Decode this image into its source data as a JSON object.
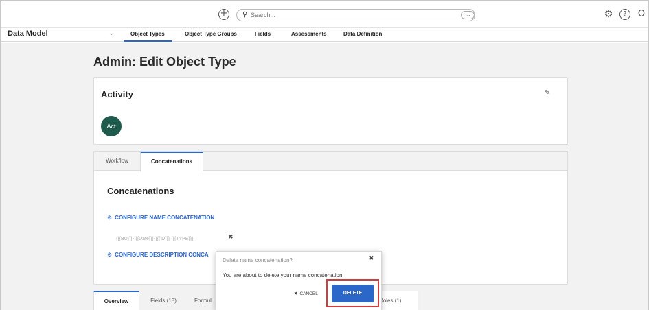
{
  "topbar": {
    "add_icon": "plus-circle-icon",
    "search": {
      "placeholder": "Search...",
      "more_label": "..."
    },
    "settings_icon": "gear-icon",
    "help_icon": "question-icon",
    "user_icon": "user-icon"
  },
  "nav": {
    "app_name": "Data Model",
    "tabs": [
      {
        "label": "Object Types"
      },
      {
        "label": "Object Type Groups"
      },
      {
        "label": "Fields"
      },
      {
        "label": "Assessments"
      },
      {
        "label": "Data Definition"
      }
    ],
    "active_tab": "Object Types",
    "accent_color": "#2b66c9"
  },
  "page": {
    "title": "Admin: Edit Object Type"
  },
  "object": {
    "name": "Activity",
    "avatar_text": "Act",
    "avatar_color": "#1e5b4d"
  },
  "upper_tabs": [
    {
      "label": "Workflow"
    },
    {
      "label": "Concatenations"
    }
  ],
  "concatenations": {
    "title": "Concatenations",
    "name_link": "CONFIGURE NAME CONCATENATION",
    "name_value": "{{{BU}}}-{{{Date}}}-{{{ID}}} {{{TYPE}}}",
    "description_link": "CONFIGURE DESCRIPTION CONCA"
  },
  "lower_tabs": [
    {
      "label": "Overview"
    },
    {
      "label": "Fields (18)"
    },
    {
      "label": "Formul"
    },
    {
      "label": "Roles (1)"
    }
  ],
  "dialog": {
    "title": "Delete name concatenation?",
    "message": "You are about to delete your name concatenation",
    "cancel_label": "CANCEL",
    "delete_label": "DELETE",
    "highlight_color": "#d23b3b"
  }
}
